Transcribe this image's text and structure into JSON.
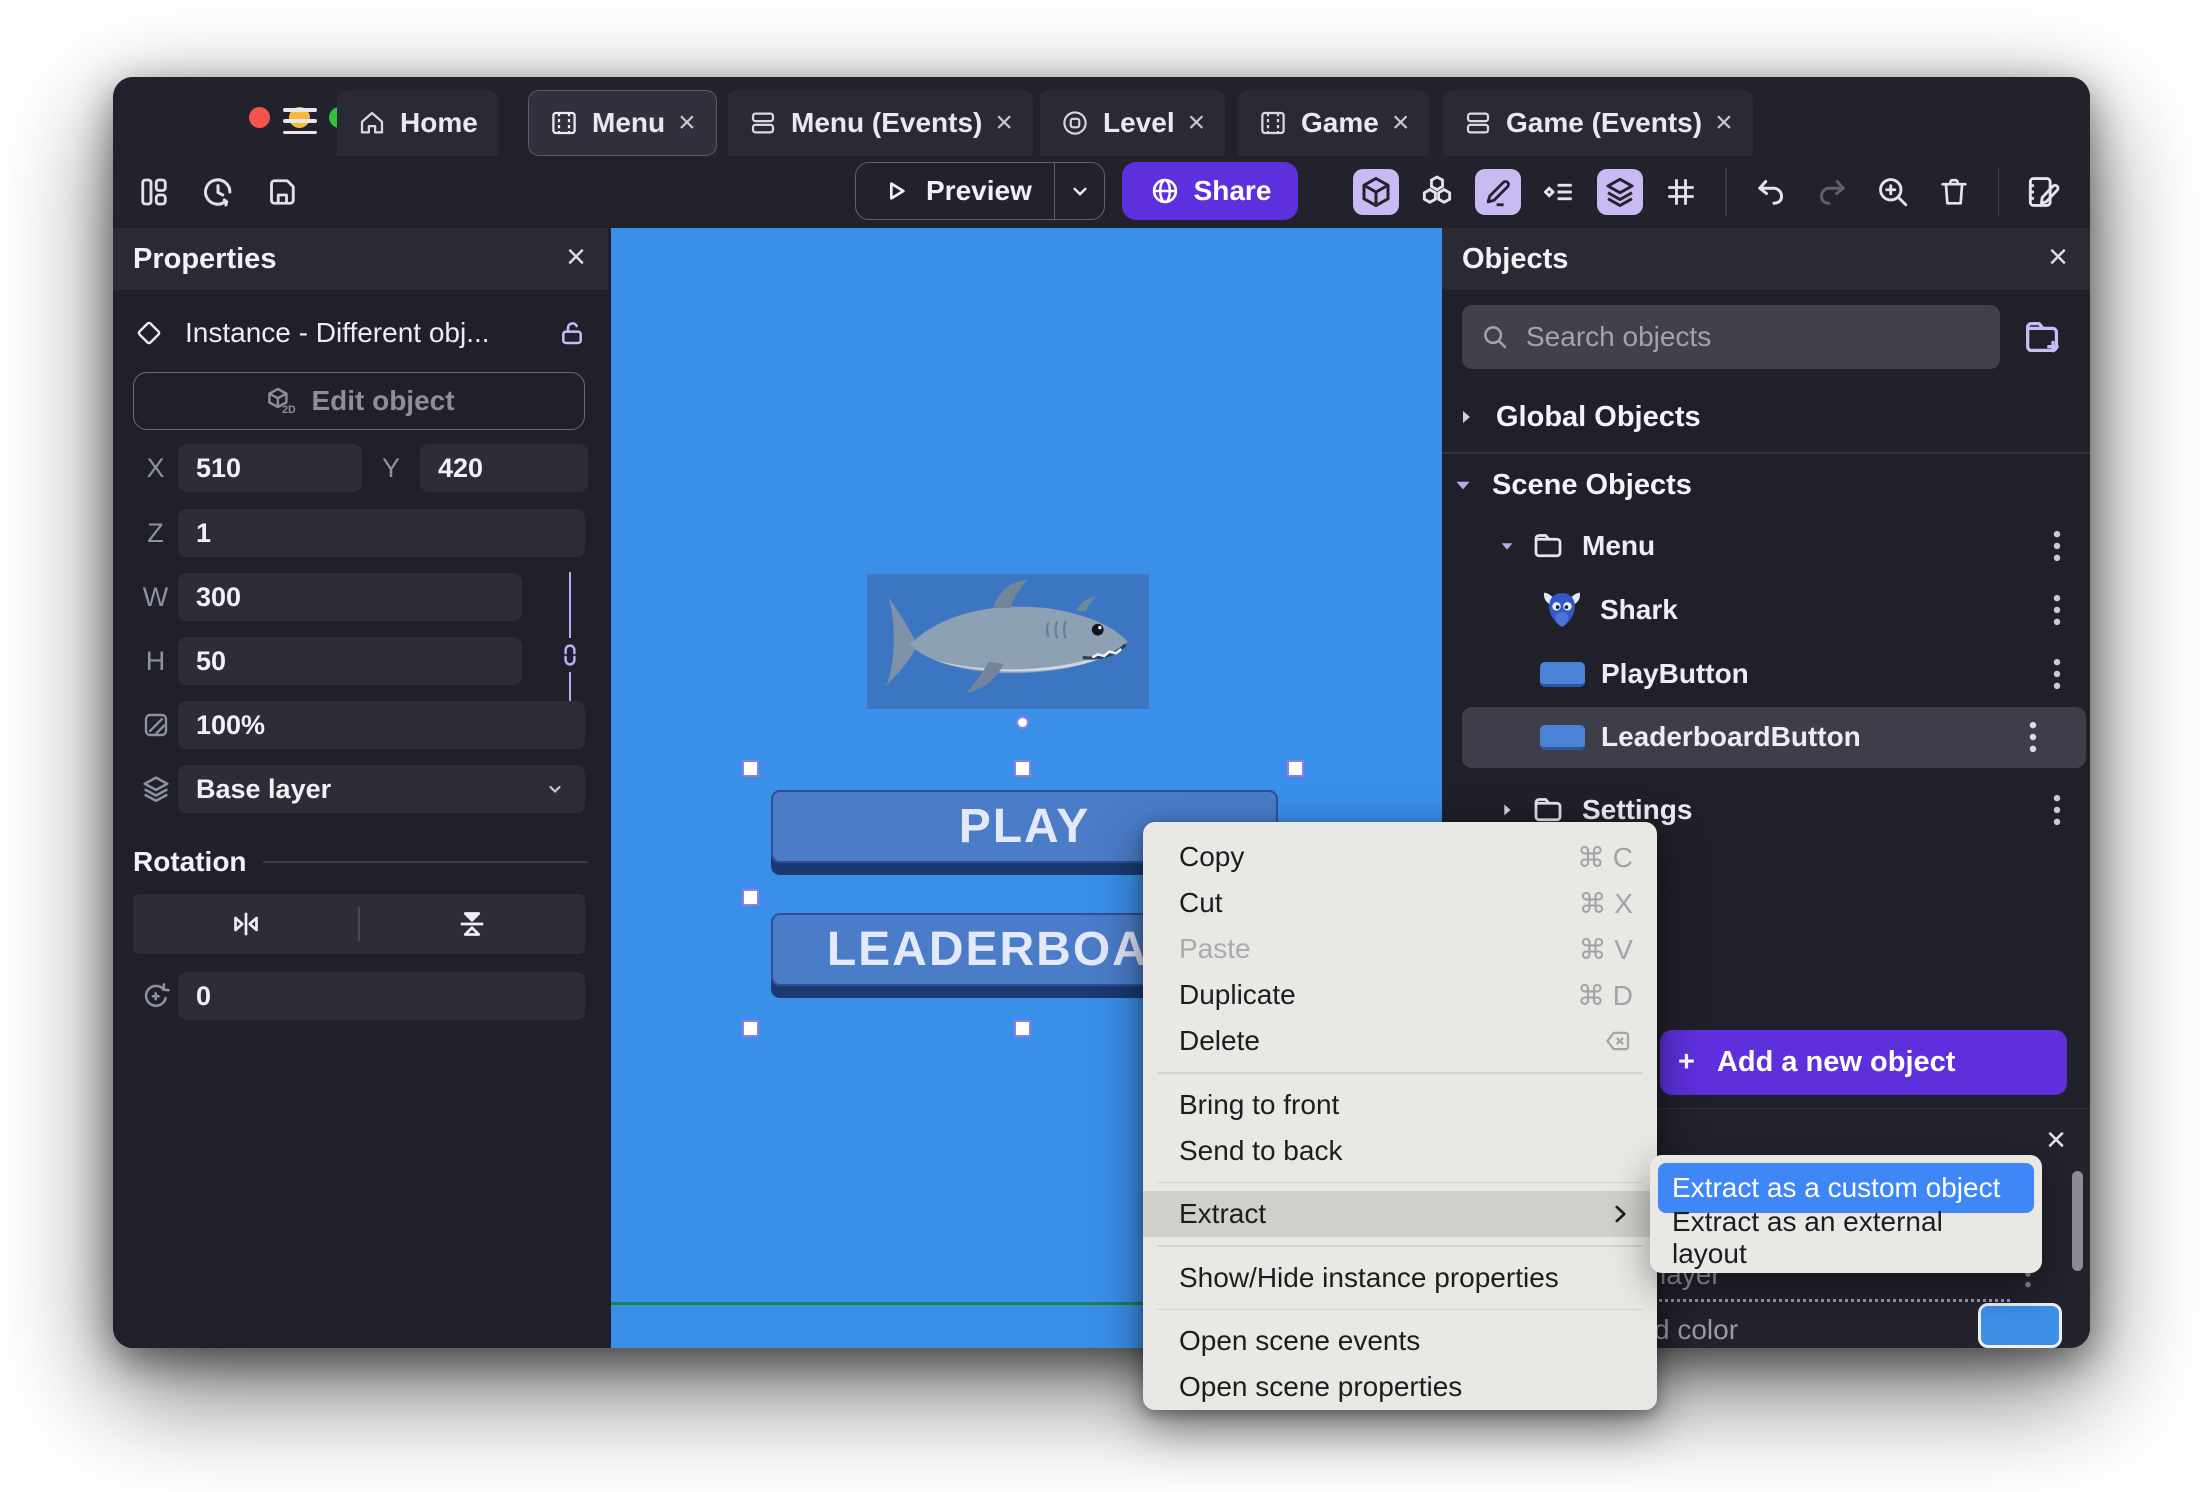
{
  "titlebar": {
    "tabs": [
      {
        "label": "Home",
        "icon": "home-icon",
        "close": ""
      },
      {
        "label": "Menu",
        "icon": "film-icon",
        "close": "×"
      },
      {
        "label": "Menu (Events)",
        "icon": "events-icon",
        "close": "×"
      },
      {
        "label": "Level",
        "icon": "level-icon",
        "close": "×"
      },
      {
        "label": "Game",
        "icon": "film-icon",
        "close": "×"
      },
      {
        "label": "Game (Events)",
        "icon": "events-icon",
        "close": "×"
      }
    ]
  },
  "toolbar": {
    "preview_label": "Preview",
    "share_label": "Share"
  },
  "properties": {
    "title": "Properties",
    "close_glyph": "×",
    "instance_label": "Instance  -  Different obj...",
    "edit_object_label": "Edit object",
    "x_label": "X",
    "x_value": "510",
    "y_label": "Y",
    "y_value": "420",
    "z_label": "Z",
    "z_value": "1",
    "w_label": "W",
    "w_value": "300",
    "h_label": "H",
    "h_value": "50",
    "opacity_value": "100%",
    "layer_value": "Base layer",
    "rotation_section_label": "Rotation",
    "rotation_value": "0"
  },
  "canvas": {
    "play_label": "PLAY",
    "leaderboard_label": "LEADERBOARD",
    "background_color": "#3a8fe8"
  },
  "objects": {
    "title": "Objects",
    "close_glyph": "×",
    "search_placeholder": "Search objects",
    "global_section": "Global Objects",
    "scene_section": "Scene Objects",
    "tree": [
      {
        "label": "Menu"
      },
      {
        "label": "Shark"
      },
      {
        "label": "PlayButton"
      },
      {
        "label": "LeaderboardButton"
      },
      {
        "label": "Settings"
      }
    ],
    "add_button_plus": "+",
    "add_button_label": "Add a new object"
  },
  "bottom_panel": {
    "close_glyph": "×",
    "layer_text_partial": "layer",
    "color_text_partial": "d color",
    "swatch_color": "#3d8fe8"
  },
  "context_menu": {
    "items": [
      {
        "label": "Copy",
        "shortcut": "⌘ C"
      },
      {
        "label": "Cut",
        "shortcut": "⌘ X"
      },
      {
        "label": "Paste",
        "shortcut": "⌘ V"
      },
      {
        "label": "Duplicate",
        "shortcut": "⌘ D"
      },
      {
        "label": "Delete",
        "shortcut": ""
      },
      {
        "label": "Bring to front",
        "shortcut": ""
      },
      {
        "label": "Send to back",
        "shortcut": ""
      },
      {
        "label": "Extract",
        "shortcut": ""
      },
      {
        "label": "Show/Hide instance properties",
        "shortcut": ""
      },
      {
        "label": "Open scene events",
        "shortcut": ""
      },
      {
        "label": "Open scene properties",
        "shortcut": ""
      }
    ]
  },
  "submenu": {
    "items": [
      {
        "label": "Extract as a custom object"
      },
      {
        "label": "Extract as an external layout"
      }
    ]
  },
  "colors": {
    "accent_purple": "#5e30dd",
    "selection_blue": "#3f86f6",
    "active_tool_bg": "#c9baf4",
    "green_guide": "#1e7f50"
  }
}
